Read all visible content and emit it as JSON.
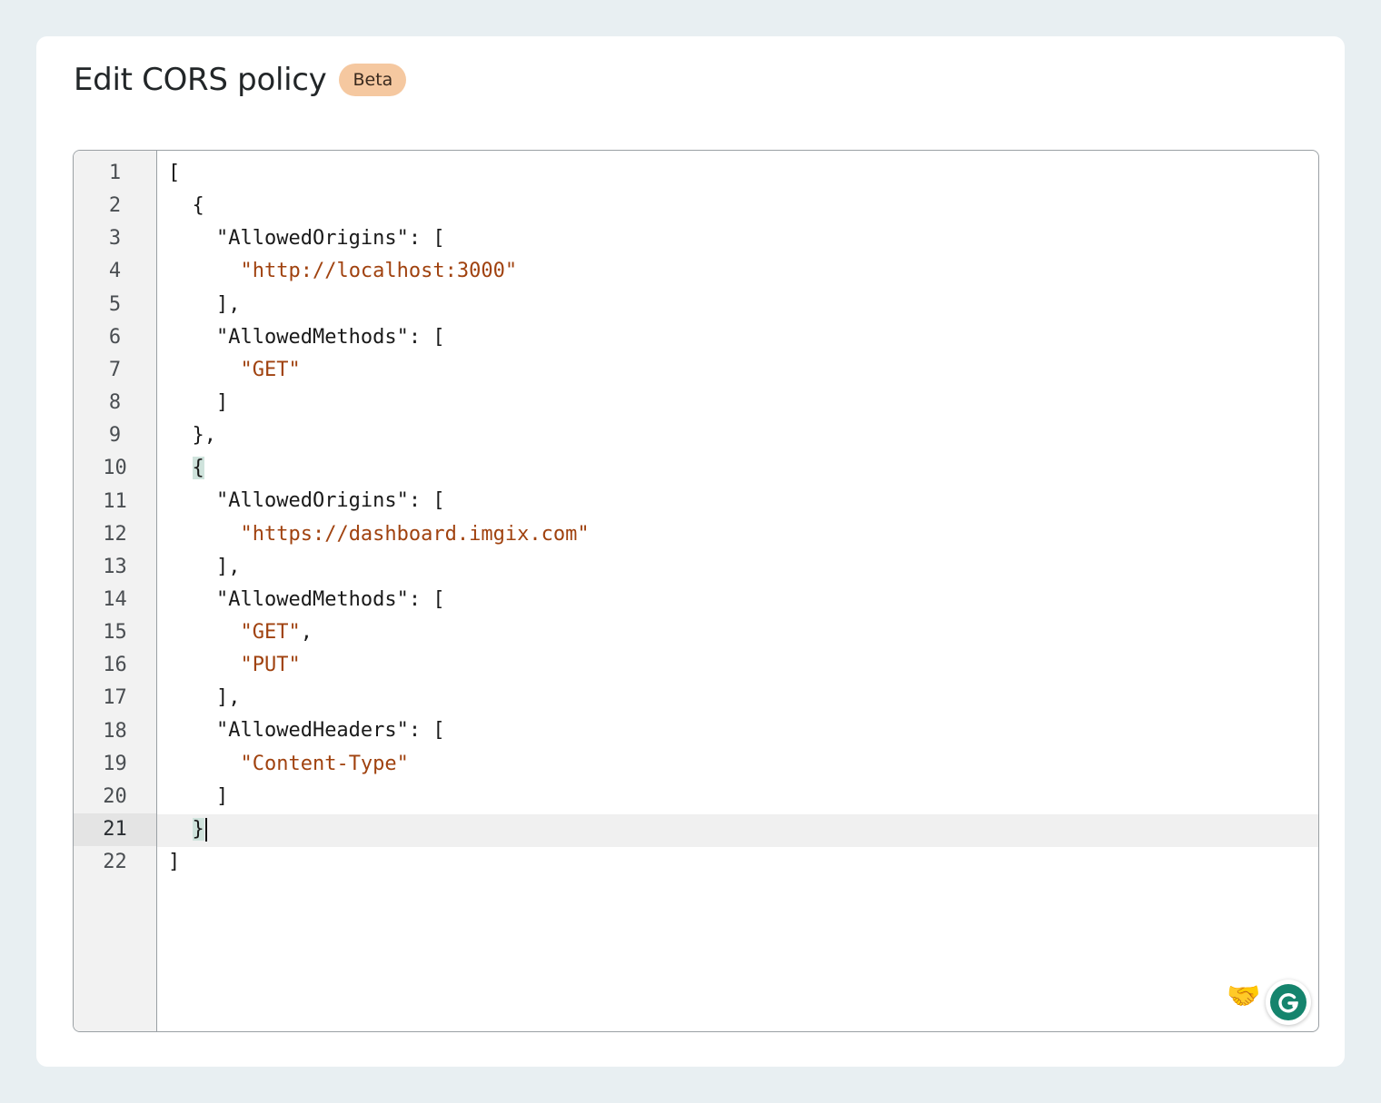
{
  "header": {
    "title": "Edit CORS policy",
    "badge": "Beta"
  },
  "editor": {
    "active_line": 21,
    "line_numbers": [
      "1",
      "2",
      "3",
      "4",
      "5",
      "6",
      "7",
      "8",
      "9",
      "10",
      "11",
      "12",
      "13",
      "14",
      "15",
      "16",
      "17",
      "18",
      "19",
      "20",
      "21",
      "22"
    ],
    "lines": [
      "[",
      "  {",
      "    \"AllowedOrigins\": [",
      "      \"http://localhost:3000\"",
      "    ],",
      "    \"AllowedMethods\": [",
      "      \"GET\"",
      "    ]",
      "  },",
      "  {",
      "    \"AllowedOrigins\": [",
      "      \"https://dashboard.imgix.com\"",
      "    ],",
      "    \"AllowedMethods\": [",
      "      \"GET\",",
      "      \"PUT\"",
      "    ],",
      "    \"AllowedHeaders\": [",
      "      \"Content-Type\"",
      "    ]",
      "  }",
      "]"
    ]
  },
  "overlays": {
    "handshake_icon": "handshake-emoji",
    "grammarly_icon": "grammarly-g-icon"
  },
  "colors": {
    "string": "#a0420f",
    "badge_bg": "#f5c8a0",
    "bracket_match": "#cfe3dc",
    "grammarly": "#15846d"
  }
}
